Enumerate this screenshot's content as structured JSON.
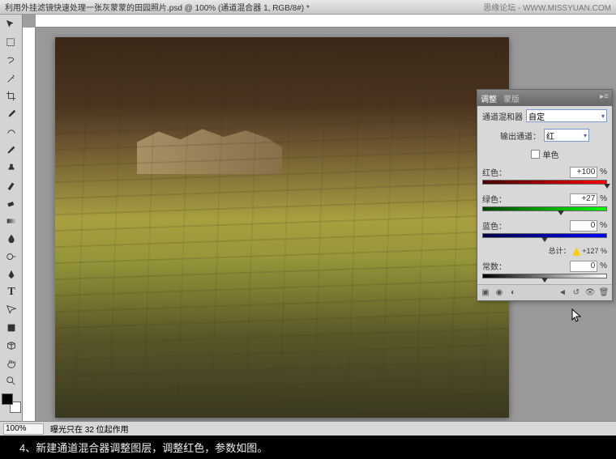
{
  "titlebar": {
    "doc": "利用外挂滤镜快速处理一张灰蒙蒙的田园照片.psd @ 100% (通道混合器 1, RGB/8#) *",
    "watermark": "思缘论坛 - WWW.MISSYUAN.COM"
  },
  "panel": {
    "tab1": "调整",
    "tab2": "蒙版",
    "title": "通道混和器",
    "preset": "自定",
    "outLabel": "输出通道：",
    "outValue": "红",
    "monoLabel": "单色",
    "red": {
      "label": "红色：",
      "value": "+100",
      "pct": "%",
      "pos": 100
    },
    "green": {
      "label": "绿色：",
      "value": "+27",
      "pct": "%",
      "pos": 63
    },
    "blue": {
      "label": "蓝色：",
      "value": "0",
      "pct": "%",
      "pos": 50
    },
    "totalLabel": "总计：",
    "totalValue": "+127",
    "totalPct": "%",
    "const": {
      "label": "常数：",
      "value": "0",
      "pct": "%",
      "pos": 50
    }
  },
  "status": {
    "zoom": "100%",
    "info": "曝光只在 32 位起作用"
  },
  "caption": "4、新建通道混合器调整图层，调整红色，参数如图。"
}
